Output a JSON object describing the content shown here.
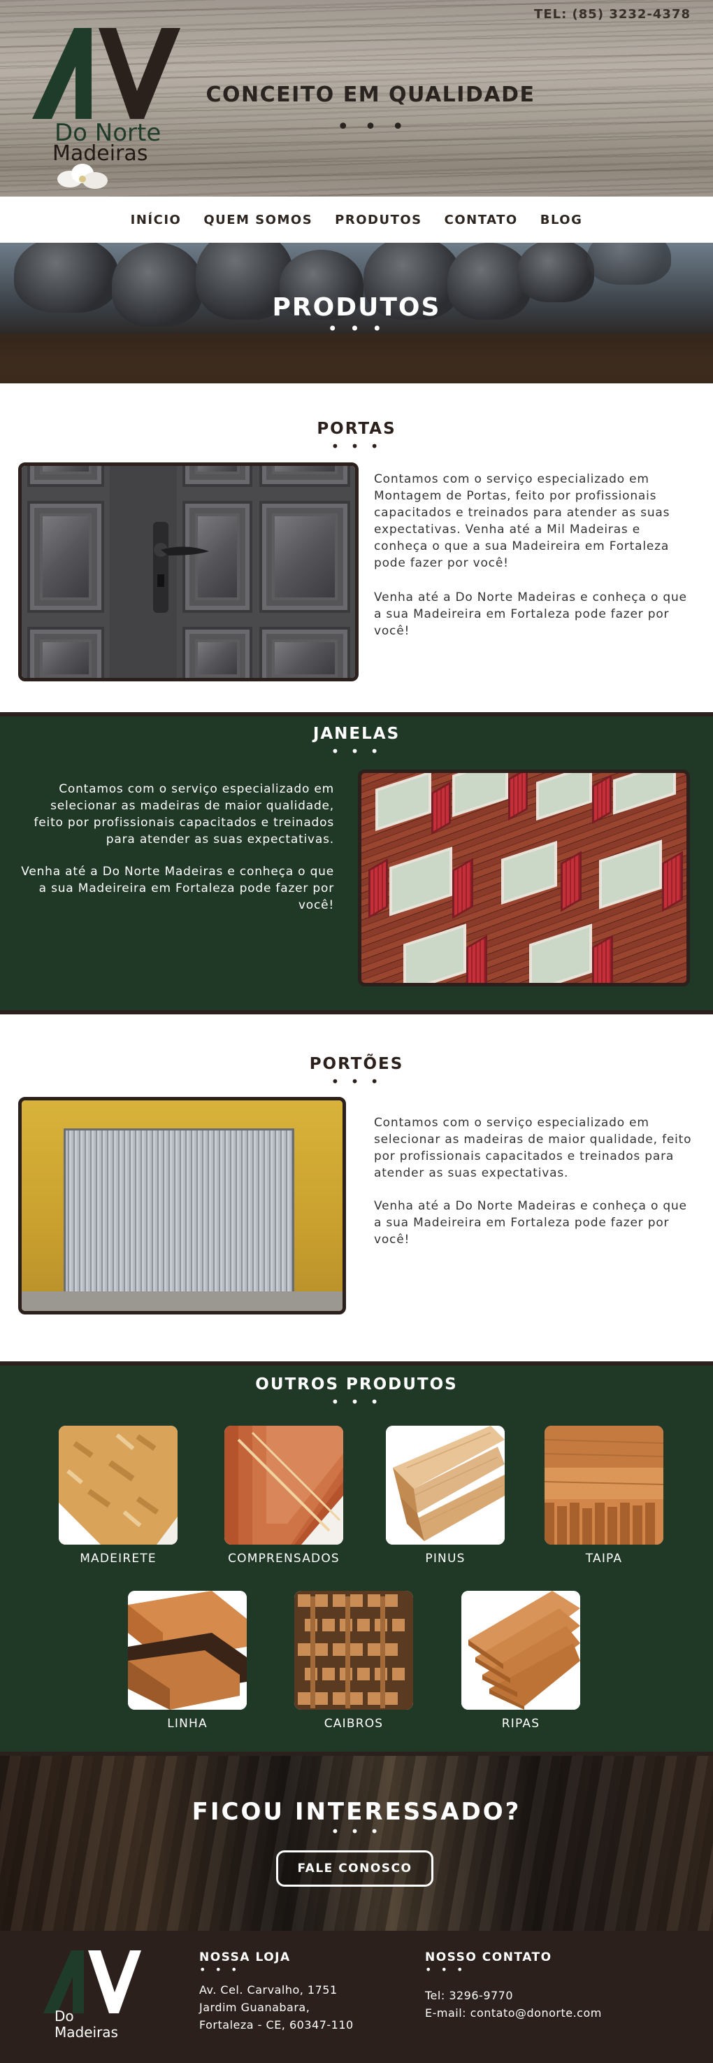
{
  "header": {
    "phone": "TEL: (85) 3232-4378",
    "logo_line1": "Do Norte",
    "logo_line2": "Madeiras",
    "tagline": "CONCEITO EM QUALIDADE",
    "tagline_dots": "• • •"
  },
  "nav": {
    "items": [
      {
        "label": "INÍCIO"
      },
      {
        "label": "QUEM SOMOS"
      },
      {
        "label": "PRODUTOS"
      },
      {
        "label": "CONTATO"
      },
      {
        "label": "BLOG"
      }
    ]
  },
  "banner": {
    "title": "PRODUTOS",
    "dots": "• • •"
  },
  "portas": {
    "title": "PORTAS",
    "dots": "• • •",
    "text1": "Contamos com o serviço especializado em Montagem de Portas, feito por profissionais capacitados e treinados para atender as suas expectativas. Venha até a Mil Madeiras e conheça o que a sua Madeireira em Fortaleza pode fazer por você!",
    "text2": "Venha até a Do Norte Madeiras e conheça o que a sua Madeireira em Fortaleza pode fazer por você!"
  },
  "janelas": {
    "title": "JANELAS",
    "dots": "• • •",
    "text1": "Contamos com o serviço especializado em selecionar as madeiras de maior qualidade, feito por profissionais capacitados e treinados para atender as suas expectativas.",
    "text2": "Venha até a Do Norte Madeiras e conheça o que a sua Madeireira em Fortaleza pode fazer por você!"
  },
  "portoes": {
    "title": "PORTÕES",
    "dots": "• • •",
    "text1": "Contamos com o serviço especializado em selecionar as madeiras de maior qualidade, feito por profissionais capacitados e treinados para atender as suas expectativas.",
    "text2": "Venha até a Do Norte Madeiras e conheça o que a sua Madeireira em Fortaleza pode fazer por você!"
  },
  "outros": {
    "title": "OUTROS PRODUTOS",
    "dots": "• • •",
    "items": [
      {
        "label": "MADEIRETE"
      },
      {
        "label": "COMPRENSADOS"
      },
      {
        "label": "PINUS"
      },
      {
        "label": "TAIPA"
      },
      {
        "label": "LINHA"
      },
      {
        "label": "CAIBROS"
      },
      {
        "label": "RIPAS"
      }
    ]
  },
  "cta": {
    "title": "FICOU INTERESSADO?",
    "dots": "• • •",
    "button": "FALE CONOSCO"
  },
  "footer": {
    "logo_line1": "Do",
    "logo_line2": "Madeiras",
    "store_title": "NOSSA LOJA",
    "store_dots": "• • •",
    "address1": "Av. Cel. Carvalho, 1751",
    "address2": "Jardim Guanabara,",
    "address3": "Fortaleza - CE, 60347-110",
    "contact_title": "NOSSO CONTATO",
    "contact_dots": "• • •",
    "phone": "Tel: 3296-9770",
    "email": "E-mail: contato@donorte.com"
  },
  "colors": {
    "brand_green": "#203826",
    "brand_dark": "#2b201c"
  }
}
